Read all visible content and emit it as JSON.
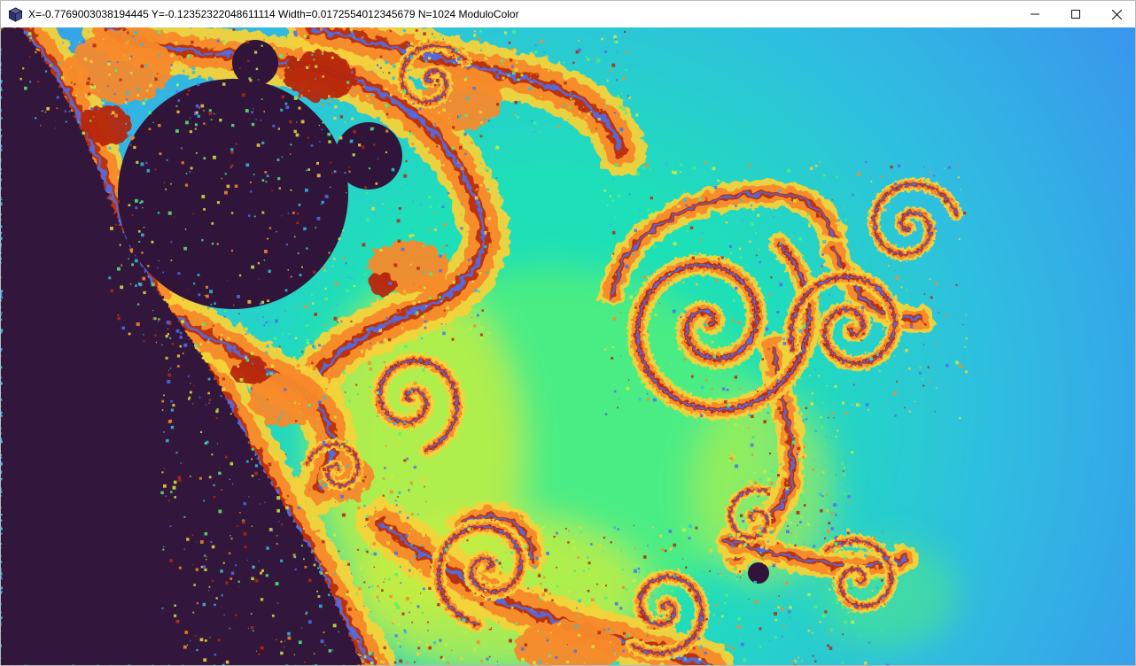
{
  "window": {
    "title": "X=-0.7769003038194445 Y=-0.12352322048611114 Width=0.0172554012345679 N=1024 ModuloColor",
    "app_icon": "cube-icon",
    "buttons": {
      "minimize_icon": "minimize-icon",
      "maximize_icon": "maximize-icon",
      "close_icon": "close-icon"
    }
  },
  "fractal": {
    "view": {
      "x": -0.7769003038194445,
      "y": -0.12352322048611114,
      "width": 0.0172554012345679,
      "iterations": 1024,
      "coloring": "ModuloColor"
    },
    "colors": {
      "interior": "#30143a",
      "background_far": "#3d86f2",
      "background_mid": "#2fbfe0",
      "background_near": "#1ee0b8",
      "green": "#52ee7a",
      "lime": "#c8ee40",
      "yellow": "#f4d23a",
      "orange": "#f7892a",
      "red": "#b5270e",
      "blue_accent": "#4f6ff0"
    }
  }
}
